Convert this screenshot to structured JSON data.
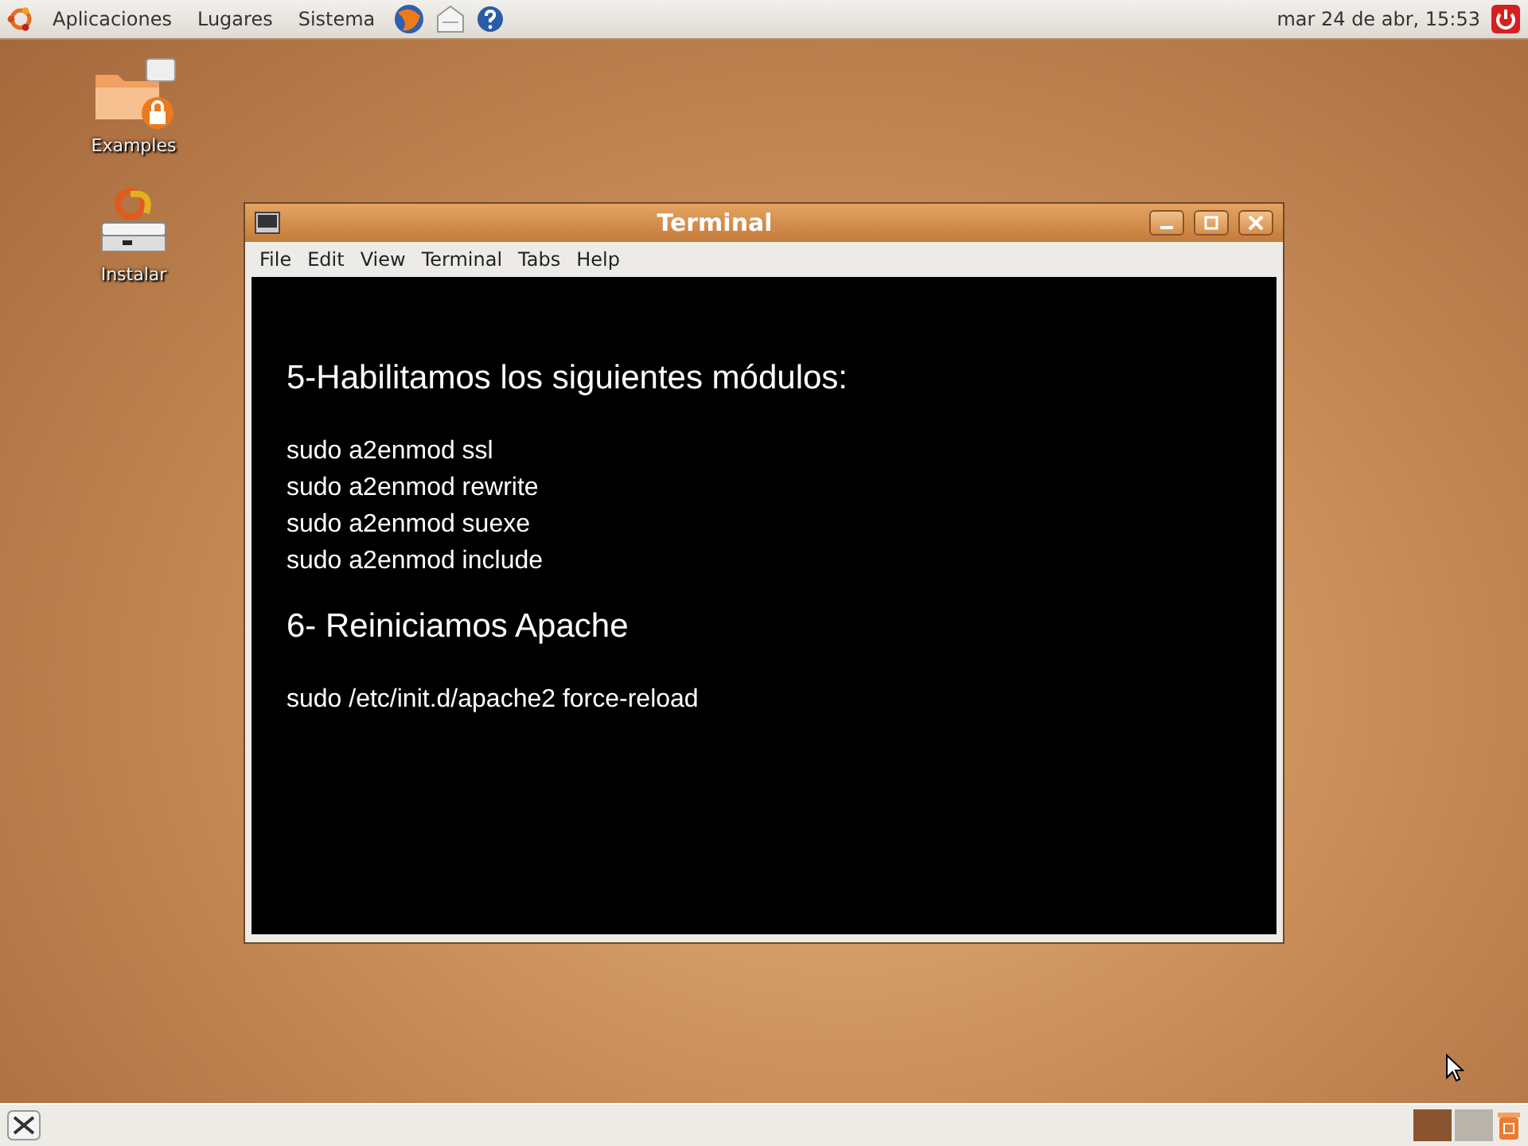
{
  "top_panel": {
    "menus": [
      "Aplicaciones",
      "Lugares",
      "Sistema"
    ],
    "clock": "mar 24 de abr, 15:53"
  },
  "desktop_icons": [
    {
      "label": "Examples",
      "kind": "folder"
    },
    {
      "label": "Instalar",
      "kind": "installer"
    }
  ],
  "window": {
    "title": "Terminal",
    "menu": [
      "File",
      "Edit",
      "View",
      "Terminal",
      "Tabs",
      "Help"
    ],
    "lines": [
      {
        "kind": "heading",
        "text": "5-Habilitamos los siguientes módulos:"
      },
      {
        "kind": "command",
        "text": "sudo a2enmod ssl"
      },
      {
        "kind": "command",
        "text": "sudo a2enmod rewrite"
      },
      {
        "kind": "command",
        "text": "sudo a2enmod suexe"
      },
      {
        "kind": "command",
        "text": "sudo a2enmod include"
      },
      {
        "kind": "heading",
        "text": "6- Reiniciamos Apache"
      },
      {
        "kind": "command",
        "text": "sudo /etc/init.d/apache2 force-reload"
      }
    ]
  }
}
